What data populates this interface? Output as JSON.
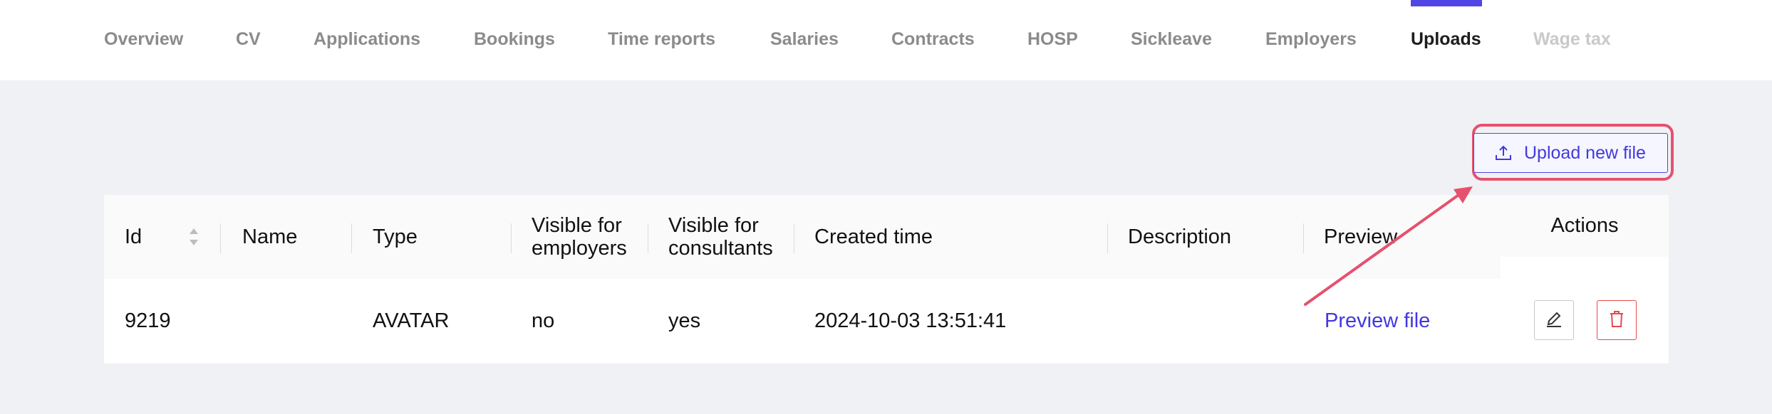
{
  "tabs": [
    {
      "label": "Overview",
      "state": "normal"
    },
    {
      "label": "CV",
      "state": "normal"
    },
    {
      "label": "Applications",
      "state": "normal"
    },
    {
      "label": "Bookings",
      "state": "normal"
    },
    {
      "label": "Time reports",
      "state": "normal"
    },
    {
      "label": "Salaries",
      "state": "normal"
    },
    {
      "label": "Contracts",
      "state": "normal"
    },
    {
      "label": "HOSP",
      "state": "normal"
    },
    {
      "label": "Sickleave",
      "state": "normal"
    },
    {
      "label": "Employers",
      "state": "normal"
    },
    {
      "label": "Uploads",
      "state": "active"
    },
    {
      "label": "Wage tax",
      "state": "disabled"
    }
  ],
  "toolbar": {
    "upload_label": "Upload new file",
    "upload_icon": "upload-icon"
  },
  "table": {
    "columns": {
      "id": "Id",
      "name": "Name",
      "type": "Type",
      "visible_employers_1": "Visible for",
      "visible_employers_2": "employers",
      "visible_consultants_1": "Visible for",
      "visible_consultants_2": "consultants",
      "created": "Created time",
      "description": "Description",
      "preview": "Preview",
      "actions": "Actions"
    },
    "rows": [
      {
        "id": "9219",
        "name": "",
        "type": "AVATAR",
        "visible_employers": "no",
        "visible_consultants": "yes",
        "created": "2024-10-03 13:51:41",
        "description": "",
        "preview": "Preview file"
      }
    ]
  },
  "colors": {
    "accent": "#5046e5",
    "annotation": "#e6516e",
    "danger": "#e34a4a"
  }
}
